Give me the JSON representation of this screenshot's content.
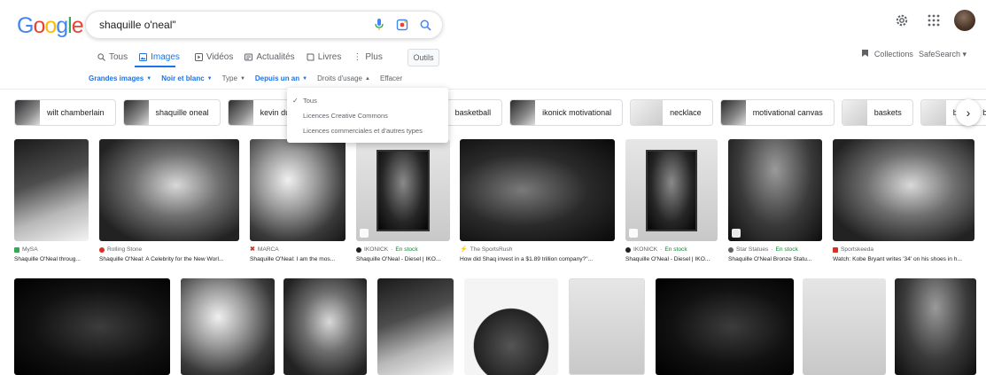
{
  "search": {
    "query": "shaquille o'neal\""
  },
  "tabs": [
    {
      "label": "Tous"
    },
    {
      "label": "Images"
    },
    {
      "label": "Vidéos"
    },
    {
      "label": "Actualités"
    },
    {
      "label": "Livres"
    },
    {
      "label": "Plus"
    }
  ],
  "tools_label": "Outils",
  "collections_label": "Collections",
  "safesearch_label": "SafeSearch",
  "filters": [
    {
      "label": "Grandes images"
    },
    {
      "label": "Noir et blanc"
    },
    {
      "label": "Type"
    },
    {
      "label": "Depuis un an"
    },
    {
      "label": "Droits d'usage"
    },
    {
      "label": "Effacer"
    }
  ],
  "chips": [
    {
      "label": "wilt chamberlain"
    },
    {
      "label": "shaquille oneal"
    },
    {
      "label": "kevin durant"
    },
    {
      "label": "basketball"
    },
    {
      "label": "ikonick motivational"
    },
    {
      "label": "necklace"
    },
    {
      "label": "motivational canvas"
    },
    {
      "label": "baskets"
    },
    {
      "label": "baskets basses"
    }
  ],
  "dropdown": {
    "items": [
      {
        "label": "Tous"
      },
      {
        "label": "Licences Creative Commons"
      },
      {
        "label": "Licences commerciales et d'autres types"
      }
    ]
  },
  "results": [
    {
      "source": "MySA",
      "caption": "Shaquille O'Neal throug...",
      "color": "#34a853"
    },
    {
      "source": "Rolling Stone",
      "caption": "Shaquille O'Neal: A Celebrity for the New Worl...",
      "color": "#d93025"
    },
    {
      "source": "MARCA",
      "caption": "Shaquille O'Neal: I am the mos...",
      "color": "#d93025"
    },
    {
      "source": "IKONICK",
      "stock": "En stock",
      "caption": "Shaquille O'Neal - Diesel | IKO...",
      "color": "#202124"
    },
    {
      "source": "The SportsRush",
      "caption": "How did Shaq invest in a $1.89 trillion company?\"...",
      "color": "#f29900"
    },
    {
      "source": "IKONICK",
      "stock": "En stock",
      "caption": "Shaquille O'Neal - Diesel | IKO...",
      "color": "#202124"
    },
    {
      "source": "Star Statues",
      "stock": "En stock",
      "caption": "Shaquille O'Neal Bronze Statu...",
      "color": "#5f6368"
    },
    {
      "source": "Sportskeeda",
      "caption": "Watch: Kobe Bryant writes '34' on his shoes in h...",
      "color": "#d93025"
    }
  ]
}
